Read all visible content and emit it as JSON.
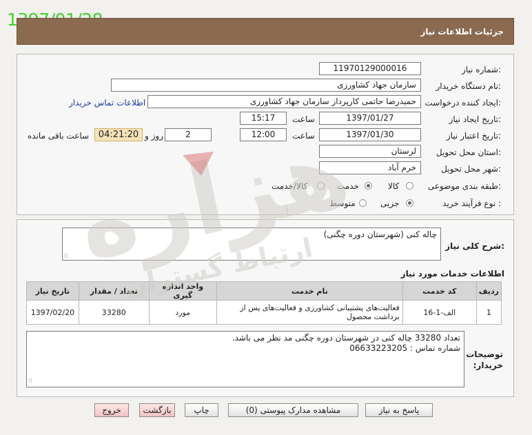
{
  "date_stamp": "1397/01/28",
  "header": {
    "title": "جزئیات اطلاعات نیاز"
  },
  "form": {
    "need_number": {
      "label": "شماره نیاز:",
      "value": "1197012900001‌6"
    },
    "buyer_org": {
      "label": "نام دستگاه خریدار:",
      "value": "سازمان جهاد کشاورزی"
    },
    "requester": {
      "label": "ایجاد کننده درخواست:",
      "value": "حمیدرضا حاتمی کارپرداز سازمان جهاد کشاورزی",
      "contact_link": "اطلاعات تماس خریدار"
    },
    "created": {
      "label": "تاریخ ایجاد نیاز:",
      "date": "1397/01/27",
      "time_label": "ساعت",
      "time": "15:17"
    },
    "validity": {
      "label": "تاریخ اعتبار نیاز:",
      "date": "1397/01/30",
      "time_label": "ساعت",
      "time": "12:00",
      "days": "2",
      "days_label": "روز و",
      "remaining": "04:21:20",
      "remaining_label": "ساعت باقی مانده"
    },
    "province": {
      "label": "استان محل تحویل:",
      "value": "لرستان"
    },
    "city": {
      "label": "شهر محل تحویل:",
      "value": "خرم آباد"
    },
    "category": {
      "label": "طبقه بندی موضوعی:",
      "options": [
        "کالا",
        "خدمت",
        "کالا/خدمت"
      ],
      "selected": "خدمت"
    },
    "process": {
      "label": "نوع فرآیند خرید :",
      "options": [
        "جزیی",
        "متوسط"
      ],
      "selected": "جزیی"
    }
  },
  "summary": {
    "label": "شرح کلی نیاز:",
    "value": "چاله کنی (شهرستان دوره چگنی)"
  },
  "services": {
    "title": "اطلاعات خدمات مورد نیاز",
    "columns": [
      "ردیف",
      "کد خدمت",
      "نام خدمت",
      "واحد اندازه گیری",
      "تعداد / مقدار",
      "تاریخ نیاز"
    ],
    "rows": [
      [
        "1",
        "الف-1-16",
        "فعالیت‌های پشتیبانی کشاورزی و فعالیت‌های پس از برداشت محصول",
        "مورد",
        "33280",
        "1397/02/20"
      ]
    ]
  },
  "buyer_notes": {
    "label": "توضیحات خریدار:",
    "line1": "تعداد 33280 چاله کنی در شهرستان دوره چگنی مد نظر می باشد.",
    "line2": "شماره تماس : 06633223205"
  },
  "buttons": {
    "reply": "پاسخ به نیاز",
    "attachments": "مشاهده مدارک پیوستی (0)",
    "print": "چاپ",
    "back": "بازگشت",
    "exit": "خروج"
  },
  "watermark": {
    "big": "هزاره",
    "small": "ارتباط گستران"
  },
  "colors": {
    "header": "#8b6a50",
    "date_stamp": "#43d22d",
    "countdown": "#f6e4b8",
    "link": "#1f3ca6"
  }
}
